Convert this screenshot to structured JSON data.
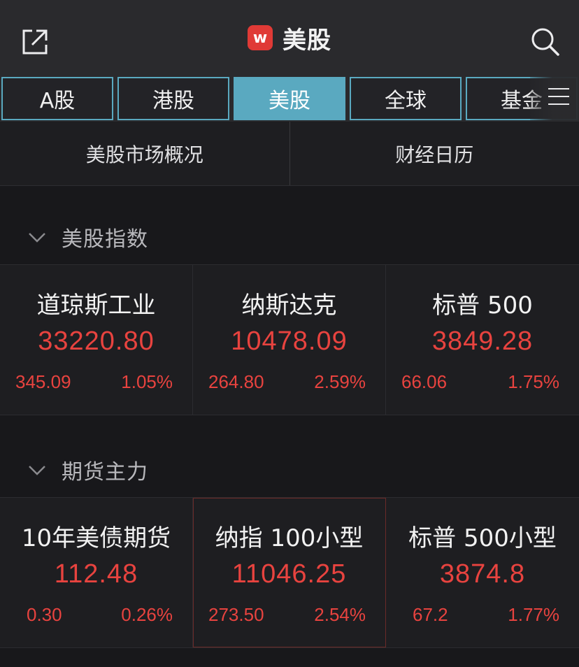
{
  "header": {
    "title": "美股",
    "logo_text": "w",
    "share_icon": "share-external-icon",
    "search_icon": "search-icon"
  },
  "tabs": [
    {
      "label": "A股",
      "active": false
    },
    {
      "label": "港股",
      "active": false
    },
    {
      "label": "美股",
      "active": true
    },
    {
      "label": "全球",
      "active": false
    },
    {
      "label": "基金",
      "active": false
    }
  ],
  "subnav": {
    "left": "美股市场概况",
    "right": "财经日历"
  },
  "sections": [
    {
      "title": "美股指数",
      "cards": [
        {
          "name": "道琼斯工业",
          "price": "33220.80",
          "change": "345.09",
          "pct": "1.05%"
        },
        {
          "name": "纳斯达克",
          "price": "10478.09",
          "change": "264.80",
          "pct": "2.59%"
        },
        {
          "name": "标普 500",
          "price": "3849.28",
          "change": "66.06",
          "pct": "1.75%"
        }
      ]
    },
    {
      "title": "期货主力",
      "cards": [
        {
          "name": "10年美债期货",
          "price": "112.48",
          "change": "0.30",
          "pct": "0.26%"
        },
        {
          "name": "纳指 100小型",
          "price": "11046.25",
          "change": "273.50",
          "pct": "2.54%"
        },
        {
          "name": "标普 500小型",
          "price": "3874.8",
          "change": "67.2",
          "pct": "1.77%"
        }
      ]
    }
  ],
  "colors": {
    "up": "#e8433f",
    "accent": "#5aa9c0",
    "background": "#18181b"
  }
}
